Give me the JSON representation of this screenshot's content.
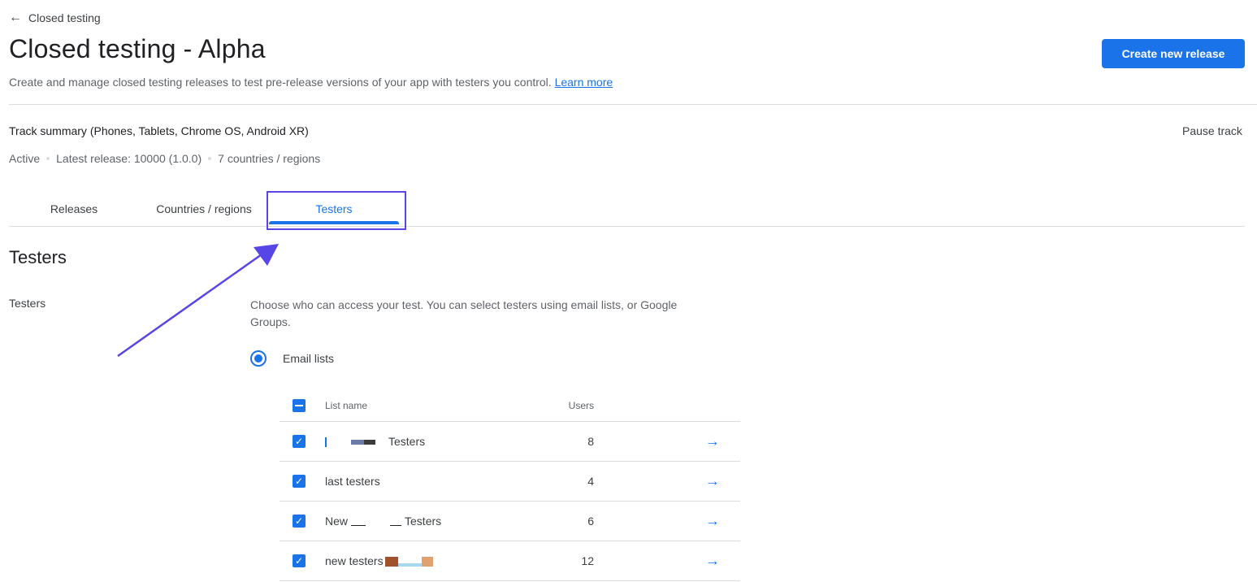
{
  "header": {
    "back_label": "Closed testing",
    "title": "Closed testing - Alpha",
    "subtitle": "Create and manage closed testing releases to test pre-release versions of your app with testers you control.",
    "learn_more": "Learn more",
    "create_release_button": "Create new release"
  },
  "track": {
    "summary": "Track summary (Phones, Tablets, Chrome OS, Android XR)",
    "pause_label": "Pause track",
    "status": "Active",
    "latest_release": "Latest release: 10000 (1.0.0)",
    "countries": "7 countries / regions"
  },
  "tabs": [
    {
      "label": "Releases",
      "selected": false
    },
    {
      "label": "Countries / regions",
      "selected": false
    },
    {
      "label": "Testers",
      "selected": true
    }
  ],
  "testers": {
    "section_title": "Testers",
    "left_label": "Testers",
    "help_text": "Choose who can access your test. You can select testers using email lists, or Google Groups.",
    "radio_label": "Email lists",
    "columns": {
      "list_name": "List name",
      "users": "Users"
    },
    "rows": [
      {
        "name": "Testers",
        "users": "8",
        "checked": true
      },
      {
        "name": "last testers",
        "users": "4",
        "checked": true
      },
      {
        "name_prefix": "New",
        "name_suffix": "Testers",
        "users": "6",
        "checked": true
      },
      {
        "name": "new testers",
        "users": "12",
        "checked": true
      }
    ]
  },
  "colors": {
    "accent": "#1a73e8",
    "annotation": "#5845e8"
  },
  "icons": {
    "back": "arrow-left-icon",
    "row_action": "arrow-right-icon",
    "checkbox": "check-icon"
  }
}
